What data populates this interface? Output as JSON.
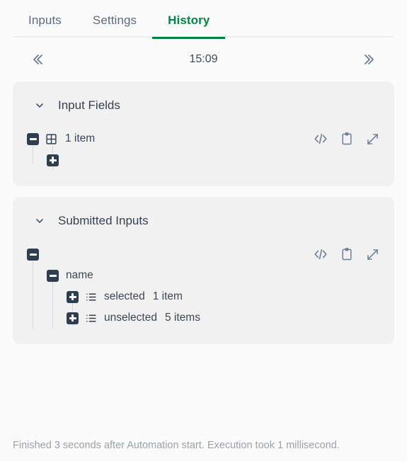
{
  "tabs": [
    {
      "label": "Inputs",
      "active": false
    },
    {
      "label": "Settings",
      "active": false
    },
    {
      "label": "History",
      "active": true
    }
  ],
  "accent_color": "#00833d",
  "pager": {
    "prev_icon": "chevron-double-left-icon",
    "next_icon": "chevron-double-right-icon",
    "time": "15:09"
  },
  "cards": [
    {
      "title": "Input Fields",
      "chevron_icon": "chevron-down-icon",
      "actions": [
        {
          "icon": "code-icon",
          "name": "view-code-button"
        },
        {
          "icon": "clipboard-icon",
          "name": "copy-button"
        },
        {
          "icon": "expand-icon",
          "name": "expand-button"
        }
      ],
      "rows": [
        {
          "indent": 1,
          "toggle": "minus",
          "icon": "table-icon",
          "label": "",
          "count": "1 item"
        },
        {
          "indent": 2,
          "toggle": "plus",
          "icon": "",
          "label": "",
          "count": ""
        }
      ]
    },
    {
      "title": "Submitted Inputs",
      "chevron_icon": "chevron-down-icon",
      "actions": [
        {
          "icon": "code-icon",
          "name": "view-code-button"
        },
        {
          "icon": "clipboard-icon",
          "name": "copy-button"
        },
        {
          "icon": "expand-icon",
          "name": "expand-button"
        }
      ],
      "rows": [
        {
          "indent": 1,
          "toggle": "minus",
          "icon": "",
          "label": "",
          "count": ""
        },
        {
          "indent": 2,
          "toggle": "minus",
          "icon": "",
          "label": "name",
          "count": ""
        },
        {
          "indent": 3,
          "toggle": "plus",
          "icon": "list-icon",
          "label": "selected",
          "count": "1 item"
        },
        {
          "indent": 3,
          "toggle": "plus",
          "icon": "list-icon",
          "label": "unselected",
          "count": "5 items"
        }
      ]
    }
  ],
  "footer": {
    "status": "Finished 3 seconds after Automation start. Execution took 1 millisecond."
  }
}
